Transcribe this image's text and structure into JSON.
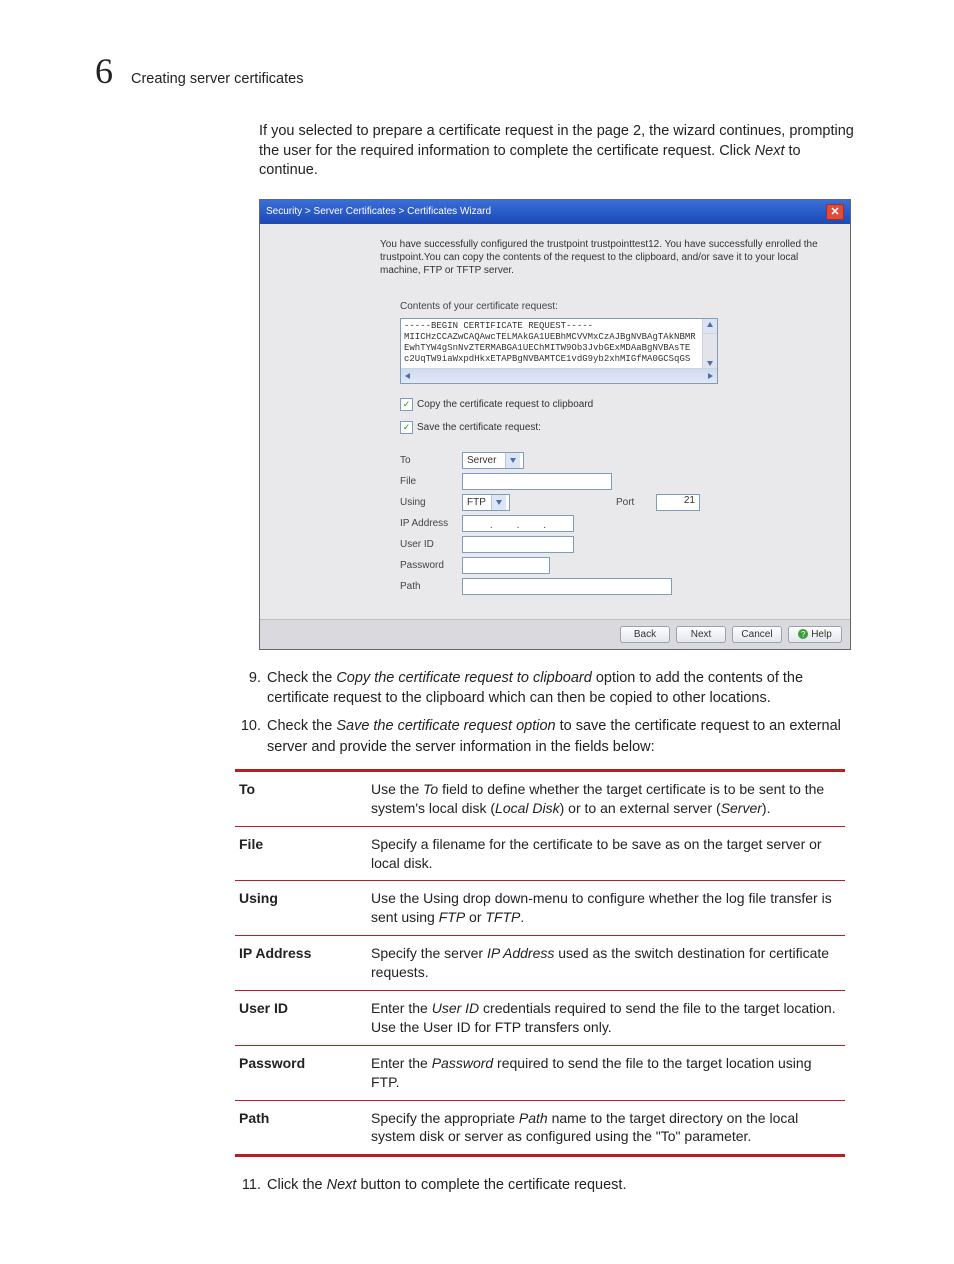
{
  "header": {
    "chapter_number": "6",
    "section_title": "Creating server certificates"
  },
  "intro_parts": {
    "a": "If you selected to prepare a certificate request in the page 2, the wizard continues, prompting the user for the required information to complete the certificate request. Click ",
    "b": "Next",
    "c": " to continue."
  },
  "wizard": {
    "title": "Security > Server Certificates > Certificates Wizard",
    "info": "You have successfully configured the trustpoint trustpointtest12. You have successfully enrolled the trustpoint.You can copy the contents of the request to the clipboard, and/or save it to your local machine, FTP or TFTP server.",
    "contents_label": "Contents of your certificate request:",
    "cert_text": "-----BEGIN CERTIFICATE REQUEST-----\nMIICHzCCAZwCAQAwcTELMAkGA1UEBhMCVVMxCzAJBgNVBAgTAkNBMR\nEwhTYW4gSnNvZTERMABGA1UEChMITW9Ob3JvbGExMDAaBgNVBAsTE\nc2UqTW9iaWxpdHkxETAPBgNVBAMTCE1vdG9yb2xhMIGfMA0GCSqGS",
    "chk_copy": "Copy the certificate request to clipboard",
    "chk_save": "Save the certificate request:",
    "labels": {
      "to": "To",
      "file": "File",
      "using": "Using",
      "port": "Port",
      "ip": "IP Address",
      "uid": "User ID",
      "pwd": "Password",
      "path": "Path"
    },
    "values": {
      "to": "Server",
      "using": "FTP",
      "port": "21"
    },
    "buttons": {
      "back": "Back",
      "next": "Next",
      "cancel": "Cancel",
      "help": "Help"
    }
  },
  "step9": {
    "num": "9.",
    "a": "Check the ",
    "b": "Copy the certificate request to clipboard",
    "c": " option to add the contents of the certificate request to the clipboard which can then be copied to other locations."
  },
  "step10": {
    "num": "10.",
    "a": "Check the ",
    "b": "Save the certificate request option",
    "c": " to save the certificate request to an external server and provide the server information in the fields below:"
  },
  "table": {
    "to": {
      "k": "To",
      "a": "Use the ",
      "b": "To",
      "c": " field to define whether the target certificate is to be sent to the system's local disk (",
      "d": "Local Disk",
      "e": ") or to an external server (",
      "f": "Server",
      "g": ")."
    },
    "file": {
      "k": "File",
      "v": "Specify a filename for the certificate to be save as on the target server or local disk."
    },
    "using": {
      "k": "Using",
      "a": "Use the Using drop down-menu to configure whether the log file transfer is sent using ",
      "b": "FTP",
      "c": " or ",
      "d": "TFTP",
      "e": "."
    },
    "ip": {
      "k": "IP Address",
      "a": "Specify the server ",
      "b": "IP Address",
      "c": " used as the switch destination for certificate requests."
    },
    "uid": {
      "k": "User ID",
      "a": "Enter the ",
      "b": "User ID",
      "c": " credentials required to send the file to the target location. Use the User ID for FTP transfers only."
    },
    "pwd": {
      "k": "Password",
      "a": "Enter the ",
      "b": "Password",
      "c": " required to send the file to the target location using FTP."
    },
    "path": {
      "k": "Path",
      "a": "Specify the appropriate ",
      "b": "Path",
      "c": " name to the target directory on the local system disk or server as configured using the \"To\" parameter."
    }
  },
  "step11": {
    "num": "11.",
    "a": "Click the ",
    "b": "Next",
    "c": " button to complete the certificate request."
  }
}
